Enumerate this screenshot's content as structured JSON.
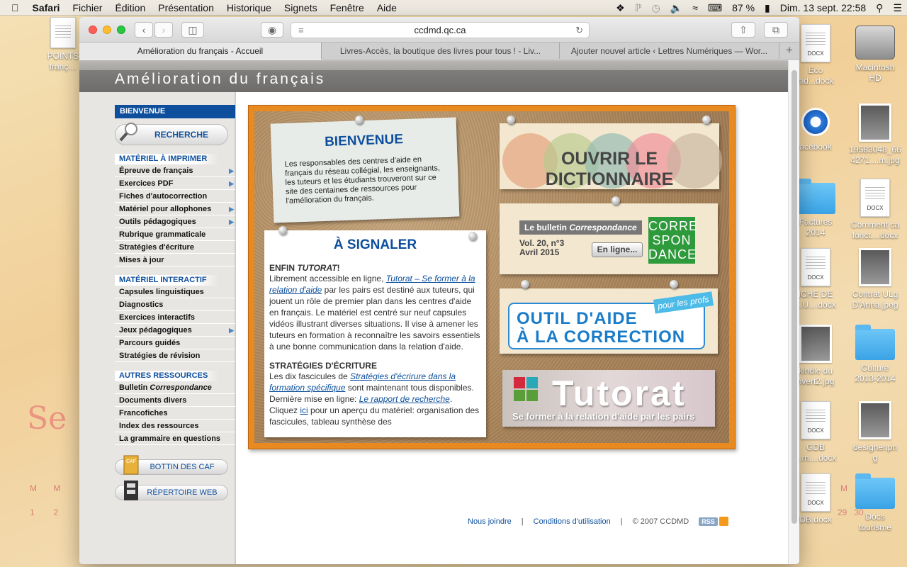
{
  "menubar": {
    "app": "Safari",
    "items": [
      "Fichier",
      "Édition",
      "Présentation",
      "Historique",
      "Signets",
      "Fenêtre",
      "Aide"
    ],
    "battery": "87 %",
    "datetime": "Dim. 13 sept.  22:58"
  },
  "desktop": {
    "left_icon": "POINTS\nfranç…",
    "items": [
      {
        "label": "Eco\nsid...docx",
        "type": "doc"
      },
      {
        "label": "Macintosh\nHD",
        "type": "hd"
      },
      {
        "label": "acebook",
        "type": "webloc"
      },
      {
        "label": "19583048_66\n4271....m.jpg",
        "type": "image"
      },
      {
        "label": "Factures\n2014",
        "type": "folder"
      },
      {
        "label": "Comment ca\nfonct....docx",
        "type": "doc"
      },
      {
        "label": "ICHE DE\n...U....docx",
        "type": "doc"
      },
      {
        "label": "Contrat ULg\nD'Anna.jpeg",
        "type": "image"
      },
      {
        "label": "kindle du\nnvert2.jpg",
        "type": "image"
      },
      {
        "label": "Culture\n2013-2014",
        "type": "folder"
      },
      {
        "label": "GDB\n...m....docx",
        "type": "doc"
      },
      {
        "label": "designer.pn\ng",
        "type": "image"
      },
      {
        "label": "DB.docx",
        "type": "doc"
      },
      {
        "label": "Docs\ntourisme",
        "type": "folder"
      }
    ],
    "doc_badge": "DOCX",
    "webloc_badge": "WEBLOC"
  },
  "browser": {
    "url": "ccdmd.qc.ca",
    "tabs": [
      "Amélioration du français - Accueil",
      "Livres-Accès, la boutique des livres pour tous ! - Liv...",
      "Ajouter nouvel article ‹ Lettres Numériques — Wor..."
    ]
  },
  "site": {
    "banner": "Amélioration du français",
    "sidebar": {
      "welcome": "BIENVENUE",
      "search": "RECHERCHE",
      "sections": [
        {
          "title": "MATÉRIEL À IMPRIMER",
          "items": [
            {
              "label": "Épreuve de français",
              "arrow": true
            },
            {
              "label": "Exercices PDF",
              "arrow": true
            },
            {
              "label": "Fiches d'autocorrection",
              "arrow": false
            },
            {
              "label": "Matériel pour allophones",
              "arrow": true
            },
            {
              "label": "Outils pédagogiques",
              "arrow": true
            },
            {
              "label": "Rubrique grammaticale",
              "arrow": false
            },
            {
              "label": "Stratégies d'écriture",
              "arrow": false
            },
            {
              "label": "Mises à jour",
              "arrow": false
            }
          ]
        },
        {
          "title": "MATÉRIEL INTERACTIF",
          "items": [
            {
              "label": "Capsules linguistiques",
              "arrow": false
            },
            {
              "label": "Diagnostics",
              "arrow": false
            },
            {
              "label": "Exercices interactifs",
              "arrow": false
            },
            {
              "label": "Jeux pédagogiques",
              "arrow": true
            },
            {
              "label": "Parcours guidés",
              "arrow": false
            },
            {
              "label": "Stratégies de révision",
              "arrow": false
            }
          ]
        },
        {
          "title": "AUTRES RESSOURCES",
          "items": [
            {
              "label": "Bulletin Correspondance",
              "arrow": false
            },
            {
              "label": "Documents divers",
              "arrow": false
            },
            {
              "label": "Francofiches",
              "arrow": false
            },
            {
              "label": "Index des ressources",
              "arrow": false
            },
            {
              "label": "La grammaire en questions",
              "arrow": false
            }
          ]
        }
      ],
      "caf_label": "CAF",
      "bottin": "BOTTIN DES CAF",
      "repertoire": "RÉPERTOIRE WEB"
    },
    "bienvenue": {
      "title": "BIENVENUE",
      "text": "Les responsables des centres d'aide en français du réseau collégial, les enseignants, les tuteurs et les étudiants trouveront sur ce site des centaines de ressources pour l'amélioration du français."
    },
    "signaler": {
      "title": "À SIGNALER",
      "h1_pre": "ENFIN ",
      "h1_em": "TUTORAT",
      "h1_post": "!",
      "p1_a": "Librement accessible en ligne, ",
      "p1_link": "Tutorat – Se former à la relation d'aide",
      "p1_b": " par les pairs est destiné aux tuteurs, qui jouent un rôle de premier plan dans les centres d'aide en français. Le matériel est centré sur neuf capsules vidéos illustrant diverses situations. Il vise à amener les tuteurs en formation à reconnaître les savoirs essentiels à une bonne communication dans la relation d'aide.",
      "h2": "STRATÉGIES D'ÉCRITURE",
      "p2_a": "Les dix fascicules de ",
      "p2_link": "Stratégies d'écrirure dans la formation spécifique",
      "p2_b": " sont maintenant tous disponibles. Dernière mise en ligne: ",
      "p2_link2": "Le rapport de recherche",
      "p2_c": ". Cliquez ",
      "p2_link3": "ici",
      "p2_d": " pour un aperçu du matériel: organisation des fascicules, tableau synthèse des"
    },
    "dictionnaire": "OUVRIR LE DICTIONNAIRE",
    "bulletin": {
      "tag_a": "Le bulletin ",
      "tag_em": "Correspondance",
      "vol": "Vol. 20, n°3",
      "date": "Avril 2015",
      "button": "En ligne...",
      "logo": "CORRE\nSPON\nDANCE"
    },
    "outil": {
      "line1": "OUTIL D'AIDE",
      "line2": "À LA CORRECTION",
      "badge": "pour les profs"
    },
    "tutorat": {
      "title": "Tutorat",
      "subtitle": "Se former à la relation d'aide par les pairs"
    },
    "footer": {
      "contact": "Nous joindre",
      "sep": "|",
      "terms": "Conditions d'utilisation",
      "copyright": "© 2007 CCDMD",
      "rss": "RSS"
    }
  },
  "colors": {
    "brand_blue": "#0d4f9c",
    "board_frame": "#e98a21",
    "circle_colors": [
      "#e3a07a",
      "#b7c98e",
      "#8fb8b0",
      "#f08a96",
      "#c7b4a0"
    ]
  }
}
